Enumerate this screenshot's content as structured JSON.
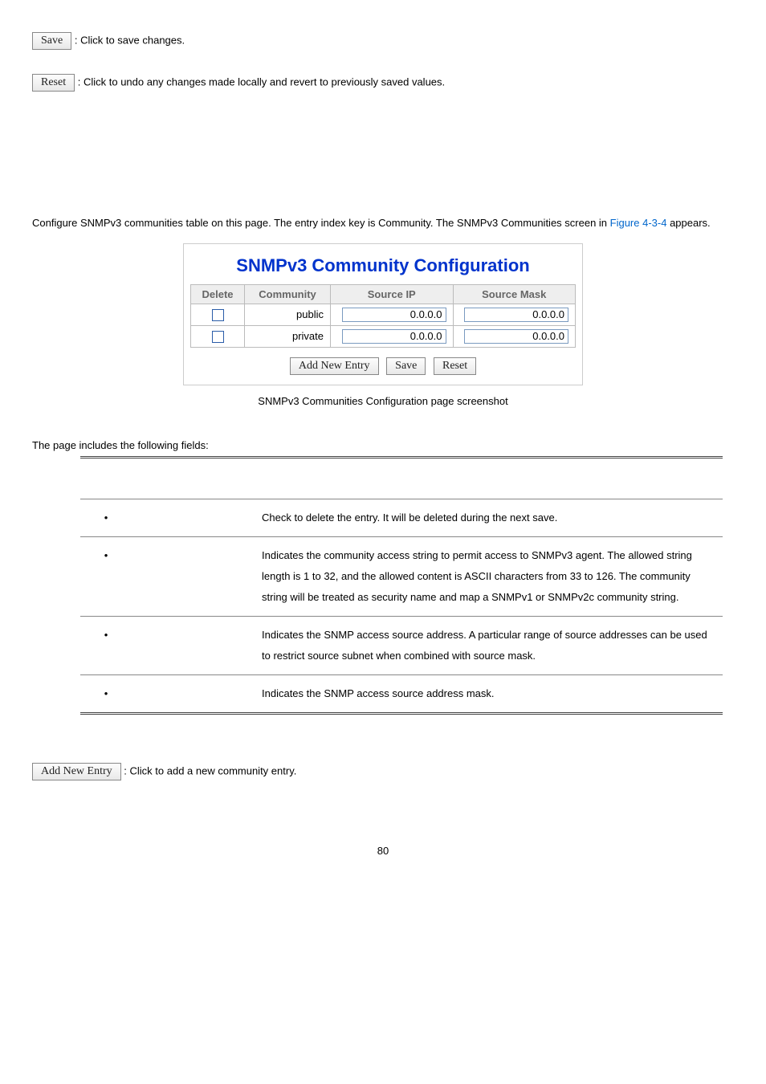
{
  "top": {
    "save_btn": "Save",
    "save_desc": ": Click to save changes.",
    "reset_btn": "Reset",
    "reset_desc": ": Click to undo any changes made locally and revert to previously saved values."
  },
  "para": {
    "pre": "Configure SNMPv3 communities table on this page. The entry index key is Community. The SNMPv3 Communities screen in ",
    "link": "Figure 4-3-4",
    "post": " appears."
  },
  "card": {
    "title": "SNMPv3 Community Configuration",
    "cols": {
      "delete": "Delete",
      "community": "Community",
      "source_ip": "Source IP",
      "source_mask": "Source Mask"
    },
    "rows": [
      {
        "community": "public",
        "source_ip": "0.0.0.0",
        "source_mask": "0.0.0.0"
      },
      {
        "community": "private",
        "source_ip": "0.0.0.0",
        "source_mask": "0.0.0.0"
      }
    ],
    "buttons": {
      "add": "Add New Entry",
      "save": "Save",
      "reset": "Reset"
    }
  },
  "caption": "SNMPv3 Communities Configuration page screenshot",
  "fields_intro": "The page includes the following fields:",
  "fields": [
    {
      "obj": "",
      "desc": "Check to delete the entry. It will be deleted during the next save."
    },
    {
      "obj": "",
      "desc": "Indicates the community access string to permit access to SNMPv3 agent. The allowed string length is 1 to 32, and the allowed content is ASCII characters from 33 to 126. The community string will be treated as security name and map a SNMPv1 or SNMPv2c community string."
    },
    {
      "obj": "",
      "desc": "Indicates the SNMP access source address. A particular range of source addresses can be used to restrict source subnet when combined with source mask."
    },
    {
      "obj": "",
      "desc": "Indicates the SNMP access source address mask."
    }
  ],
  "footer": {
    "add_btn": "Add New Entry",
    "add_desc": ": Click to add a new community entry."
  },
  "page_number": "80"
}
